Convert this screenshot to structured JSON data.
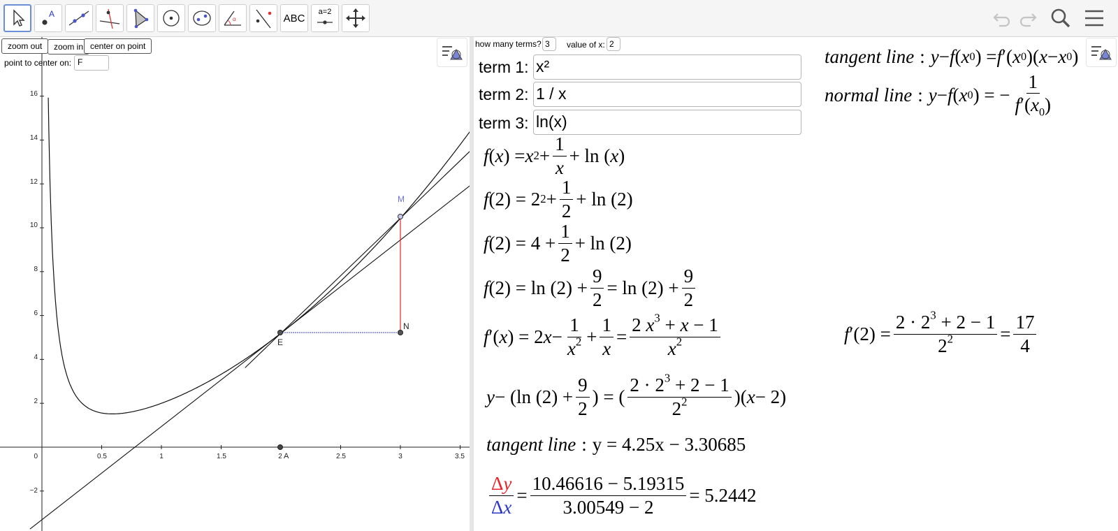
{
  "toolbar": {
    "text_tool_label": "ABC",
    "slider_tool_label": "a=2"
  },
  "graphics": {
    "zoom_out_label": "zoom out",
    "zoom_in_label": "zoom in",
    "center_on_point_label": "center on point",
    "point_to_center_label": "point to center on:",
    "point_to_center_value": "F",
    "y_tick_labels": [
      "16",
      "14",
      "12",
      "10",
      "8",
      "6",
      "4",
      "2",
      "0",
      "−2"
    ],
    "x_tick_labels": [
      "0.5",
      "1",
      "1.5",
      "2",
      "2.5",
      "3",
      "3.5"
    ],
    "points": {
      "M": "M",
      "N": "N",
      "E": "E",
      "A": "A"
    }
  },
  "panel": {
    "terms_label": "how many terms?",
    "terms_value": "3",
    "x_value_label": "value of x:",
    "x_value": "2",
    "term1_label": "term 1:",
    "term1_value": "x²",
    "term2_label": "term 2:",
    "term2_value": "1 / x",
    "term3_label": "term 3:",
    "term3_value": "ln(x)",
    "tangent_line_text": "tangent line",
    "normal_line_text": "normal line",
    "tangent_result": "y = 4.25x − 3.30685",
    "slope_numerator": "10.46616 − 5.19315",
    "slope_denominator": "3.00549 − 2",
    "slope_result": "= 5.2442",
    "derivative_value": "17",
    "derivative_value_den": "4"
  },
  "colors": {
    "tangent_red": "#e8242b",
    "delta_blue": "#2a36c8",
    "point_label_blue": "#6d73d6"
  }
}
